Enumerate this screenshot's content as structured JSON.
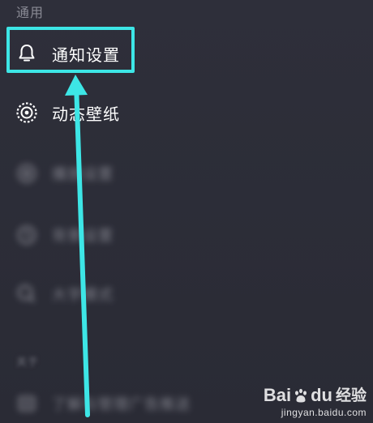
{
  "settings": {
    "section_general": "通用",
    "section_about": "关于",
    "items": [
      {
        "label": "通知设置",
        "icon": "bell-icon"
      },
      {
        "label": "动态壁纸",
        "icon": "live-wallpaper-icon"
      },
      {
        "label": "播放设置",
        "icon": "settings-icon"
      },
      {
        "label": "背景设置",
        "icon": "clock-icon"
      },
      {
        "label": "大字模式",
        "icon": "search-icon"
      },
      {
        "label": "了解与管理广告推送",
        "icon": "list-icon"
      }
    ]
  },
  "annotation": {
    "highlight_color": "#3de6e6",
    "arrow_color": "#3de6e6"
  },
  "watermark": {
    "logo_left": "Bai",
    "logo_right": "du",
    "logo_cn": "经验",
    "url": "jingyan.baidu.com"
  }
}
